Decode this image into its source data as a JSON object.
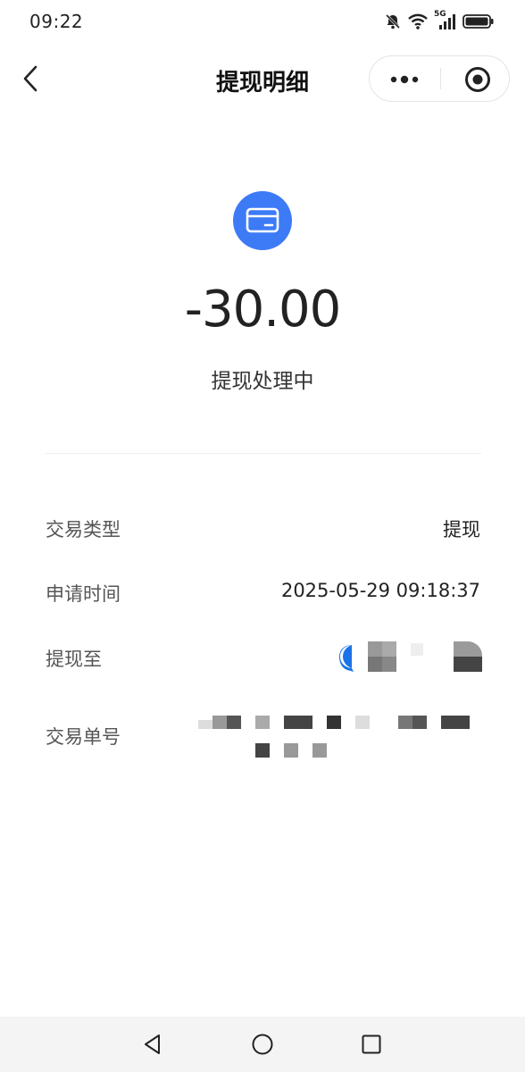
{
  "status_bar": {
    "time": "09:22",
    "network": "5G",
    "icons": [
      "mute-bell-icon",
      "wifi-icon",
      "signal-icon",
      "battery-icon"
    ]
  },
  "nav": {
    "title": "提现明细",
    "back_icon": "chevron-left-icon",
    "more_icon": "more-dots-icon",
    "close_icon": "target-circle-icon"
  },
  "summary": {
    "icon": "card-icon",
    "amount": "-30.00",
    "status": "提现处理中"
  },
  "details": [
    {
      "label": "交易类型",
      "value": "提现"
    },
    {
      "label": "申请时间",
      "value": "2025-05-29 09:18:37"
    },
    {
      "label": "提现至",
      "value": ""
    },
    {
      "label": "交易单号",
      "value": ""
    }
  ],
  "bottom_nav": {
    "icons": [
      "triangle-back-icon",
      "circle-home-icon",
      "square-recents-icon"
    ]
  },
  "colors": {
    "accent": "#3d7bf6",
    "text": "#222222",
    "label": "#555555",
    "bottom_bar": "#f4f4f4"
  }
}
